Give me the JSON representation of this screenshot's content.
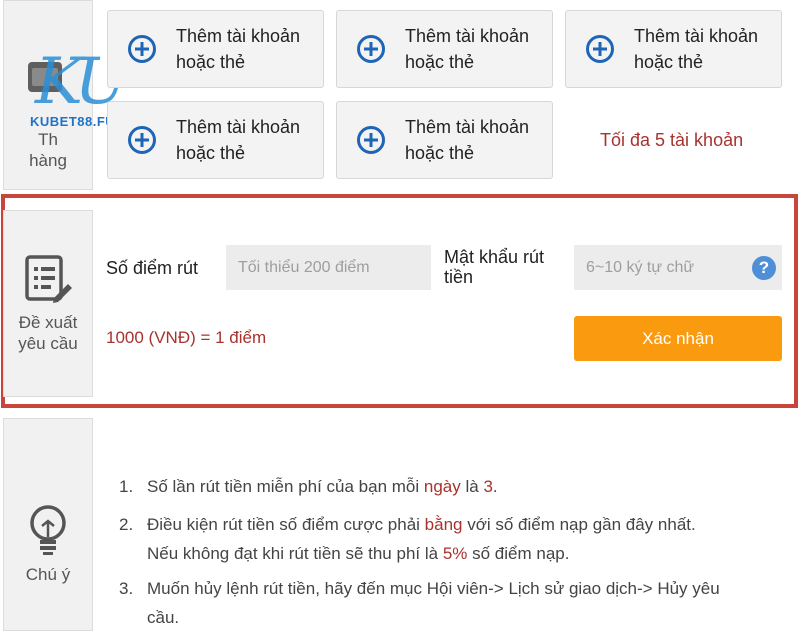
{
  "bank_section": {
    "label": "Thẻ ngân hàng",
    "label_visible_top": "Th",
    "label_visible_bottom": "hàng"
  },
  "add_cards": [
    {
      "label_line1": "Thêm tài khoản",
      "label_line2": "hoặc thẻ"
    },
    {
      "label_line1": "Thêm tài khoản",
      "label_line2": "hoặc thẻ"
    },
    {
      "label_line1": "Thêm tài khoản",
      "label_line2": "hoặc thẻ"
    },
    {
      "label_line1": "Thêm tài khoản",
      "label_line2": "hoặc thẻ"
    },
    {
      "label_line1": "Thêm tài khoản",
      "label_line2": "hoặc thẻ"
    }
  ],
  "max_accounts_note": "Tối đa 5 tài khoản",
  "watermark": {
    "text": "KU",
    "subtext": "KUBET88.FUN"
  },
  "withdraw": {
    "side_label_line1": "Đề xuất",
    "side_label_line2": "yêu cầu",
    "points_label": "Số điểm rút",
    "points_placeholder": "Tối thiểu 200 điểm",
    "password_label_line1": "Mật khẩu rút",
    "password_label_line2": "tiền",
    "password_placeholder": "6~10 ký tự chữ",
    "help_symbol": "?",
    "rate_text": "1000 (VNĐ) = 1 điểm",
    "confirm_label": "Xác nhận",
    "colors": {
      "border": "#c9453c",
      "button": "#f99a0f",
      "accent_text": "#a8322d"
    }
  },
  "notice": {
    "side_label": "Chú ý",
    "items": [
      {
        "num": "1.",
        "parts": [
          "Số lần rút tiền miễn phí của bạn mỗi ",
          "ngày",
          " là ",
          "3",
          "."
        ]
      },
      {
        "num": "2.",
        "line1_parts": [
          "Điều kiện rút tiền số điểm cược phải ",
          "bằng",
          " với số điểm nạp gần đây nhất."
        ],
        "line2_parts": [
          "Nếu không đạt khi rút tiền sẽ thu phí là ",
          "5%",
          " số điểm nạp."
        ]
      },
      {
        "num": "3.",
        "line1": "Muốn hủy lệnh rút tiền, hãy đến mục Hội viên-> Lịch sử giao dịch-> Hủy yêu",
        "line2": "cầu."
      }
    ]
  }
}
